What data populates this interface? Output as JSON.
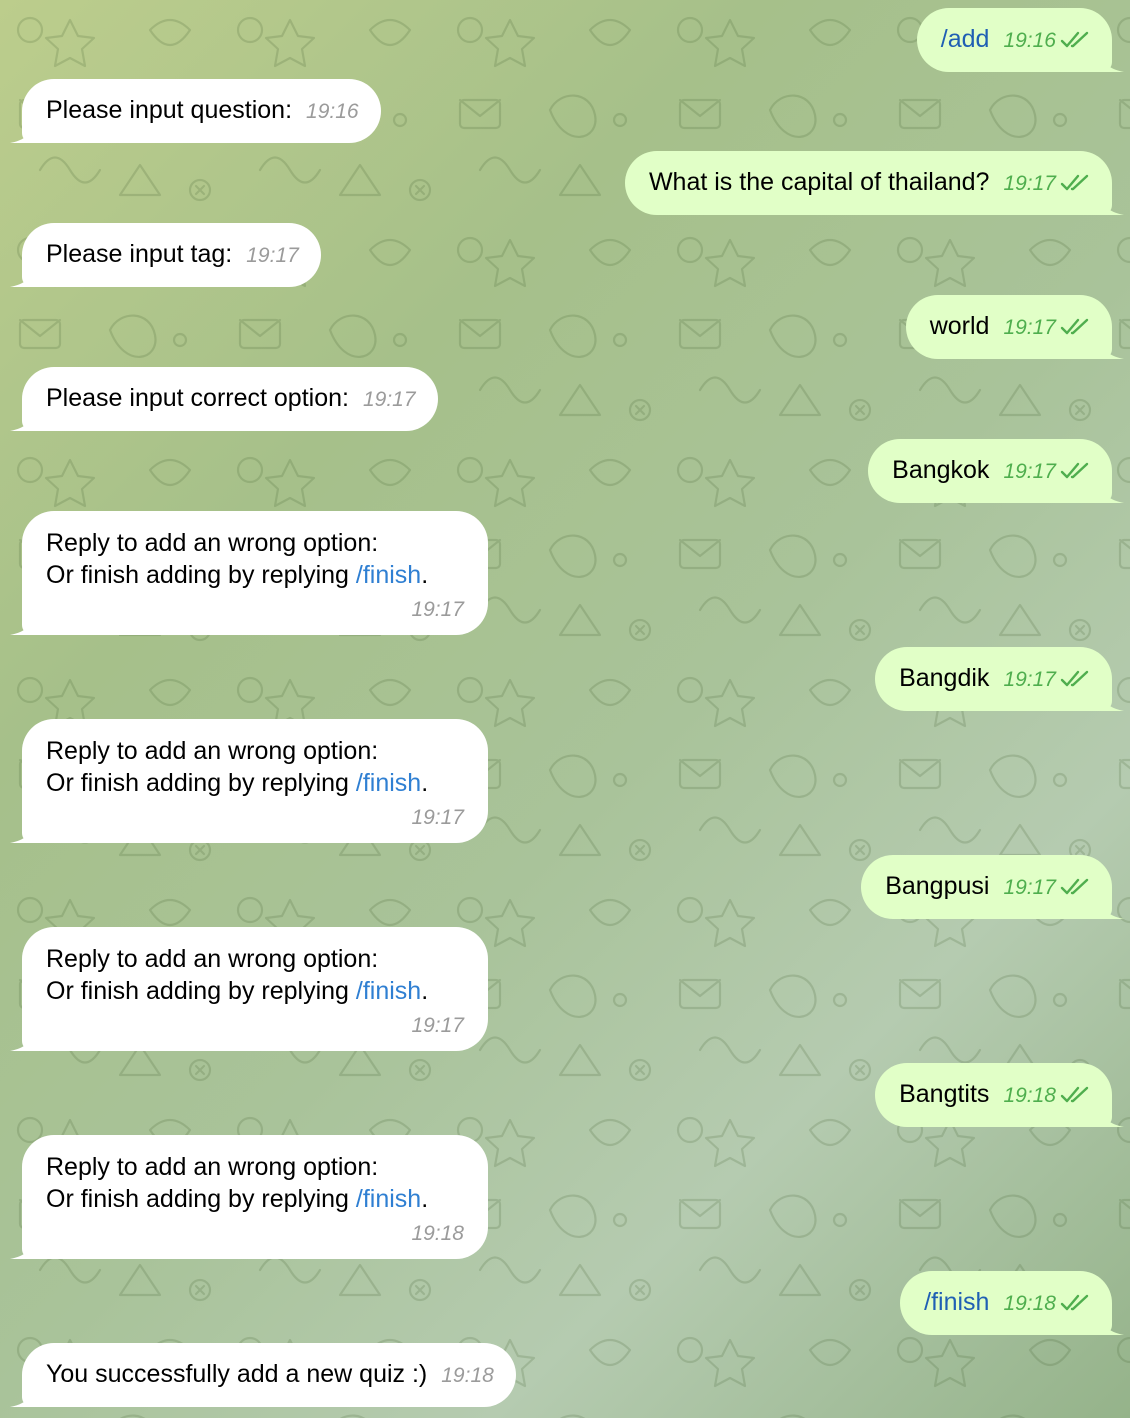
{
  "messages": [
    {
      "id": "m1",
      "side": "out",
      "text": "/add",
      "is_command": true,
      "time": "19:16",
      "read": true
    },
    {
      "id": "m2",
      "side": "in",
      "text": "Please input question:",
      "time": "19:16"
    },
    {
      "id": "m3",
      "side": "out",
      "text": "What is the capital of thailand?",
      "time": "19:17",
      "read": true
    },
    {
      "id": "m4",
      "side": "in",
      "text": "Please input tag:",
      "time": "19:17"
    },
    {
      "id": "m5",
      "side": "out",
      "text": "world",
      "time": "19:17",
      "read": true
    },
    {
      "id": "m6",
      "side": "in",
      "text": "Please input correct option:",
      "time": "19:17"
    },
    {
      "id": "m7",
      "side": "out",
      "text": "Bangkok",
      "time": "19:17",
      "read": true
    },
    {
      "id": "m8",
      "side": "in",
      "line1": "Reply to add an wrong option:",
      "line2_prefix": "Or finish adding by replying ",
      "line2_command": "/finish",
      "line2_suffix": ".",
      "time": "19:17"
    },
    {
      "id": "m9",
      "side": "out",
      "text": "Bangdik",
      "time": "19:17",
      "read": true
    },
    {
      "id": "m10",
      "side": "in",
      "line1": "Reply to add an wrong option:",
      "line2_prefix": "Or finish adding by replying ",
      "line2_command": "/finish",
      "line2_suffix": ".",
      "time": "19:17"
    },
    {
      "id": "m11",
      "side": "out",
      "text": "Bangpusi",
      "time": "19:17",
      "read": true
    },
    {
      "id": "m12",
      "side": "in",
      "line1": "Reply to add an wrong option:",
      "line2_prefix": "Or finish adding by replying ",
      "line2_command": "/finish",
      "line2_suffix": ".",
      "time": "19:17"
    },
    {
      "id": "m13",
      "side": "out",
      "text": "Bangtits",
      "time": "19:18",
      "read": true
    },
    {
      "id": "m14",
      "side": "in",
      "line1": "Reply to add an wrong option:",
      "line2_prefix": "Or finish adding by replying ",
      "line2_command": "/finish",
      "line2_suffix": ".",
      "time": "19:18"
    },
    {
      "id": "m15",
      "side": "out",
      "text": "/finish",
      "is_command": true,
      "time": "19:18",
      "read": true
    },
    {
      "id": "m16",
      "side": "in",
      "text": "You successfully add a new quiz :)",
      "time": "19:18"
    }
  ],
  "colors": {
    "incoming_bubble": "#ffffff",
    "outgoing_bubble": "#e1ffc7",
    "outgoing_time": "#4fae4e",
    "incoming_time": "#9b9b9b",
    "command_link": "#2f7fd2"
  },
  "icons": {
    "read_receipt": "double-check-icon",
    "background": "doodle-pattern"
  }
}
